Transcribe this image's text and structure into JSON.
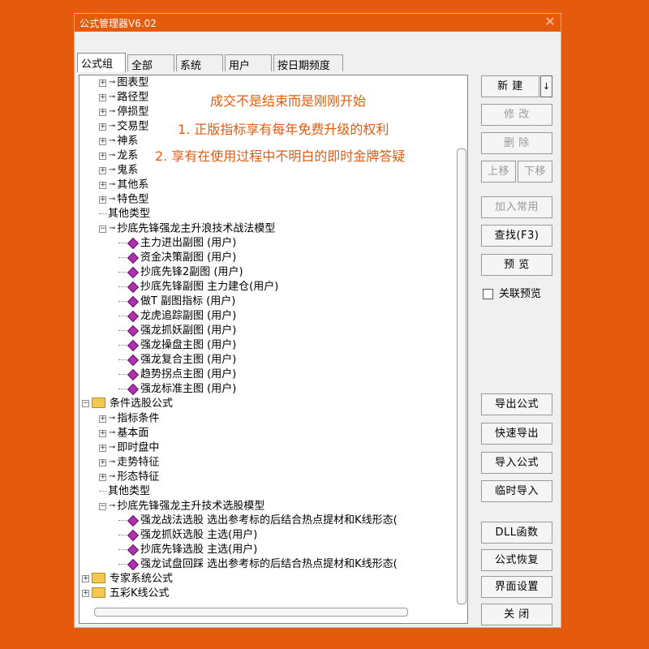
{
  "window": {
    "title": "公式管理器V6.02",
    "close_glyph": "✕"
  },
  "tabs": [
    "公式组",
    "全部",
    "系统",
    "用户",
    "按日期频度"
  ],
  "tree": [
    {
      "text": "图表型",
      "type": "node"
    },
    {
      "text": "路径型",
      "type": "node"
    },
    {
      "text": "停损型",
      "type": "node"
    },
    {
      "text": "交易型",
      "type": "node"
    },
    {
      "text": "神系",
      "type": "node"
    },
    {
      "text": "龙系",
      "type": "node"
    },
    {
      "text": "鬼系",
      "type": "node"
    },
    {
      "text": "其他系",
      "type": "node"
    },
    {
      "text": "特色型",
      "type": "node"
    },
    {
      "text": "其他类型",
      "type": "leafnode"
    },
    {
      "text": "抄底先锋强龙主升浪技术战法模型",
      "type": "opennode"
    },
    {
      "text": "主力进出副图  (用户)",
      "type": "formula"
    },
    {
      "text": "资金决策副图  (用户)",
      "type": "formula"
    },
    {
      "text": "抄底先锋2副图  (用户)",
      "type": "formula"
    },
    {
      "text": "抄底先锋副图  主力建仓(用户)",
      "type": "formula"
    },
    {
      "text": "做T 副图指标  (用户)",
      "type": "formula"
    },
    {
      "text": "龙虎追踪副图  (用户)",
      "type": "formula"
    },
    {
      "text": "强龙抓妖副图  (用户)",
      "type": "formula"
    },
    {
      "text": "强龙操盘主图  (用户)",
      "type": "formula"
    },
    {
      "text": "强龙复合主图  (用户)",
      "type": "formula"
    },
    {
      "text": "趋势拐点主图  (用户)",
      "type": "formula"
    },
    {
      "text": "强龙标准主图  (用户)",
      "type": "formula"
    },
    {
      "text": "条件选股公式",
      "type": "folder"
    },
    {
      "text": "指标条件",
      "type": "node"
    },
    {
      "text": "基本面",
      "type": "node"
    },
    {
      "text": "即时盘中",
      "type": "node"
    },
    {
      "text": "走势特征",
      "type": "node"
    },
    {
      "text": "形态特征",
      "type": "node"
    },
    {
      "text": "其他类型",
      "type": "leafnode"
    },
    {
      "text": "抄底先锋强龙主升技术选股模型",
      "type": "opennode"
    },
    {
      "text": "强龙战法选股  选出参考标的后结合热点提材和K线形态(",
      "type": "formula"
    },
    {
      "text": "强龙抓妖选股  主选(用户)",
      "type": "formula"
    },
    {
      "text": "抄底先锋选股  主选(用户)",
      "type": "formula"
    },
    {
      "text": "强龙试盘回踩  选出参考标的后结合热点提材和K线形态(",
      "type": "formula"
    },
    {
      "text": "专家系统公式",
      "type": "folder"
    },
    {
      "text": "五彩K线公式",
      "type": "folder"
    }
  ],
  "notes": [
    "成交不是结束而是刚刚开始",
    "1.  正版指标享有每年免费升级的权利",
    "2.  享有在使用过程中不明白的即时金牌答疑"
  ],
  "buttons": {
    "new": "新  建",
    "new_arrow": "↓",
    "modify": "修  改",
    "delete": "删  除",
    "up": "上移",
    "down": "下移",
    "add_common": "加入常用",
    "find": "查找(F3)",
    "preview": "预  览",
    "assoc_preview": "关联预览",
    "export": "导出公式",
    "quick_export": "快速导出",
    "import": "导入公式",
    "temp_import": "临时导入",
    "dll": "DLL函数",
    "restore": "公式恢复",
    "ui_settings": "界面设置",
    "close": "关  闭"
  },
  "colors": {
    "accent": "#e55b0d",
    "formula_gem": "#b030b0",
    "folder": "#f2c94c"
  }
}
